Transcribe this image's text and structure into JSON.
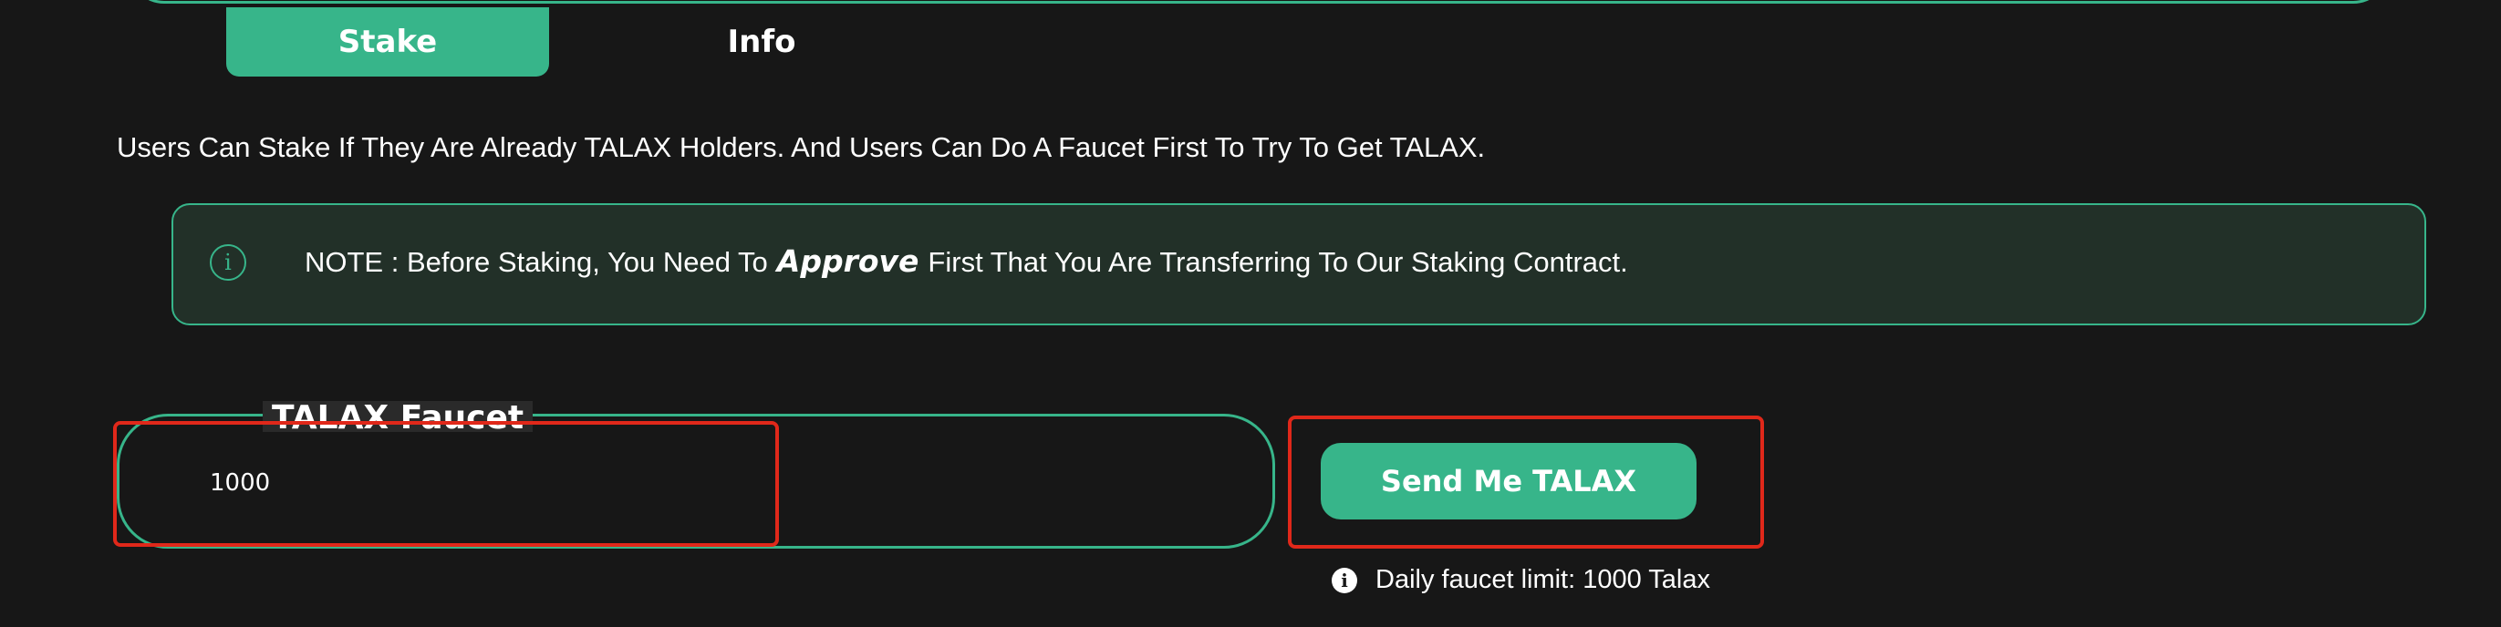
{
  "tabs": [
    {
      "label": "Stake",
      "active": true
    },
    {
      "label": "Info",
      "active": false
    }
  ],
  "description": "Users Can Stake If They Are Already TALAX Holders. And Users Can Do A Faucet First To Try To Get TALAX.",
  "note": {
    "icon": "info-outline-icon",
    "prefix": "NOTE : Before Staking, You Need To",
    "emphasis": "Approve",
    "suffix": "First That You Are Transferring To Our Staking Contract."
  },
  "faucet": {
    "label": "TALAX Faucet",
    "input_value": "1000",
    "button_label": "Send Me TALAX",
    "limit_icon": "info-filled-icon",
    "limit_text": "Daily faucet limit: 1000 Talax"
  },
  "colors": {
    "background": "#171717",
    "accent": "#37b58a",
    "note_background": "#223028",
    "highlight": "#e0281a"
  }
}
